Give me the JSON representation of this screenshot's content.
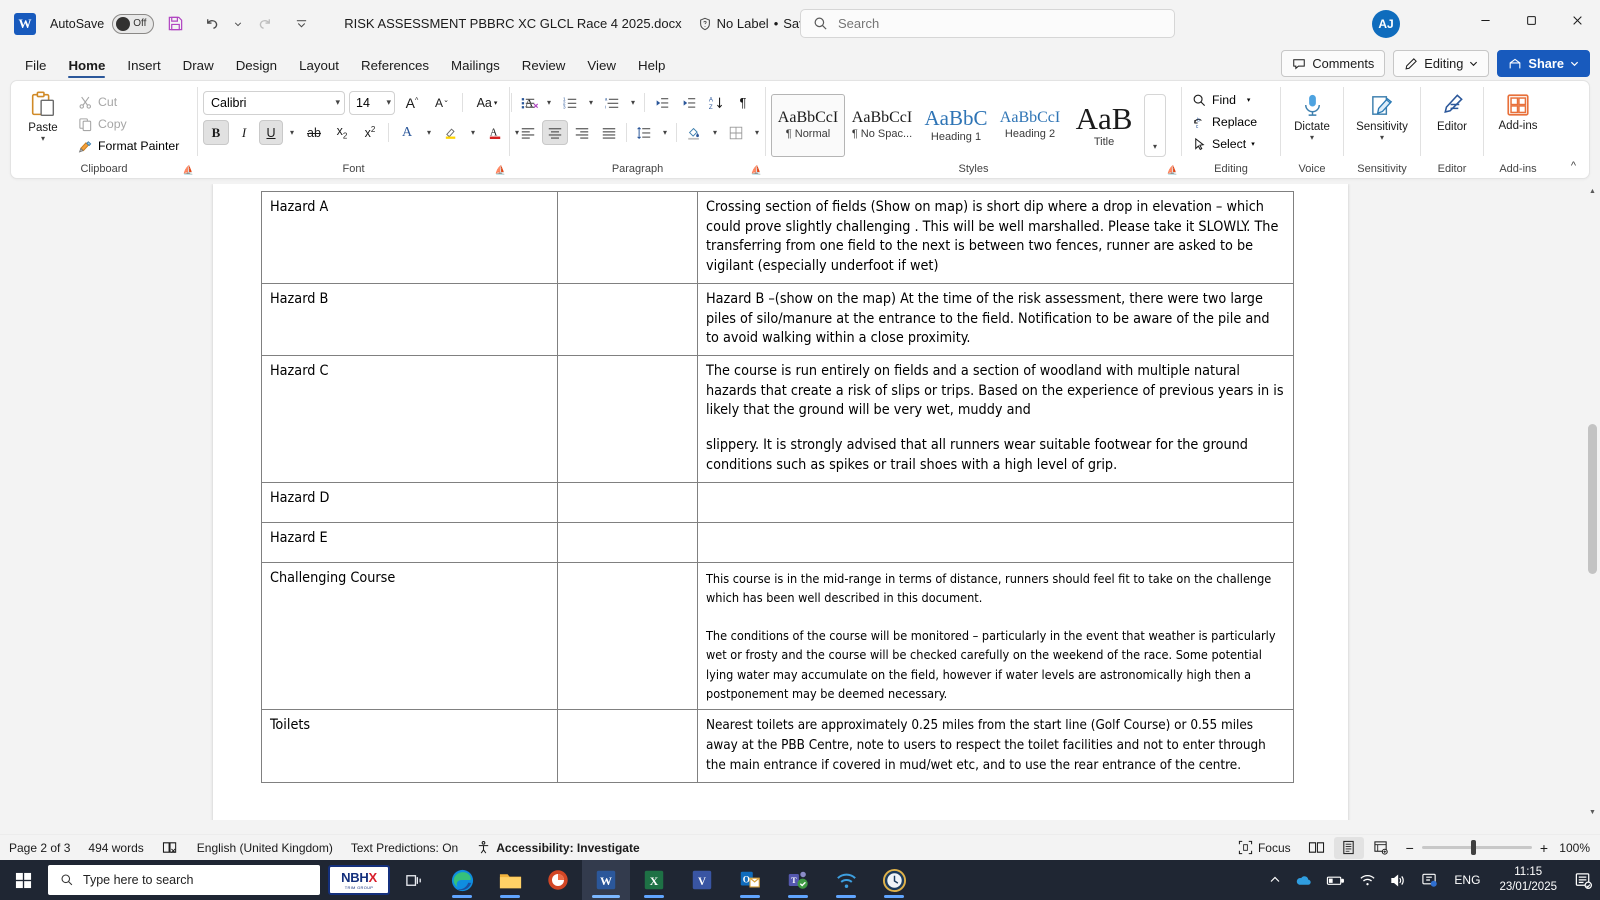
{
  "titlebar": {
    "app_logo": "word-logo",
    "autosave_label": "AutoSave",
    "autosave_state": "Off",
    "document_name": "RISK ASSESSMENT PBBRC XC GLCL Race 4 2025.docx",
    "sensitivity_label": "No Label",
    "save_state": "Saved to this PC",
    "separator": "•",
    "account_initials": "AJ"
  },
  "search": {
    "placeholder": "Search"
  },
  "tabs": [
    {
      "label": "File",
      "active": false
    },
    {
      "label": "Home",
      "active": true
    },
    {
      "label": "Insert",
      "active": false
    },
    {
      "label": "Draw",
      "active": false
    },
    {
      "label": "Design",
      "active": false
    },
    {
      "label": "Layout",
      "active": false
    },
    {
      "label": "References",
      "active": false
    },
    {
      "label": "Mailings",
      "active": false
    },
    {
      "label": "Review",
      "active": false
    },
    {
      "label": "View",
      "active": false
    },
    {
      "label": "Help",
      "active": false
    }
  ],
  "ribbon_actions": {
    "comments": "Comments",
    "editing": "Editing",
    "share": "Share"
  },
  "ribbon": {
    "clipboard": {
      "group_label": "Clipboard",
      "paste": "Paste",
      "cut": "Cut",
      "copy": "Copy",
      "format_painter": "Format Painter"
    },
    "font": {
      "group_label": "Font",
      "font_name": "Calibri",
      "font_size": "14",
      "bold_active": true
    },
    "paragraph": {
      "group_label": "Paragraph"
    },
    "styles": {
      "group_label": "Styles",
      "items": [
        {
          "preview": "AaBbCcI",
          "name": "¶ Normal",
          "selected": true
        },
        {
          "preview": "AaBbCcI",
          "name": "¶ No Spac...",
          "selected": false
        },
        {
          "preview": "AaBbC",
          "name": "Heading 1",
          "selected": false
        },
        {
          "preview": "AaBbCcI",
          "name": "Heading 2",
          "selected": false
        },
        {
          "preview": "AaB",
          "name": "Title",
          "selected": false
        }
      ]
    },
    "editing": {
      "group_label": "Editing",
      "find": "Find",
      "replace": "Replace",
      "select": "Select"
    },
    "voice": {
      "group_label": "Voice",
      "dictate": "Dictate"
    },
    "sensitivity": {
      "group_label": "Sensitivity",
      "button": "Sensitivity"
    },
    "editor": {
      "group_label": "Editor",
      "button": "Editor"
    },
    "addins": {
      "group_label": "Add-ins",
      "button": "Add-ins"
    }
  },
  "document": {
    "table_rows": [
      {
        "label": "Hazard A",
        "mid": "",
        "paragraphs": [
          "Crossing section of fields (Show on map) is short dip where a drop in elevation – which could prove slightly challenging .  This will be well marshalled.  Please take it SLOWLY.  The transferring from one field to the next is between two fences, runner are asked to be vigilant (especially underfoot if wet)"
        ]
      },
      {
        "label": "Hazard B",
        "mid": "",
        "paragraphs": [
          "Hazard B –(show on the map)  At the time of the risk assessment, there were two large piles of silo/manure at the entrance to the field. Notification to be aware of the pile and to avoid walking within a close proximity."
        ]
      },
      {
        "label": "Hazard C",
        "mid": "",
        "paragraphs": [
          "The course is run entirely on fields and a section of woodland with multiple natural hazards that create a risk of slips or trips. Based on the experience of previous years in is likely that the ground will be very wet, muddy and",
          "slippery. It is strongly advised that all runners wear suitable footwear for the ground conditions such as spikes or trail shoes with a high level of grip."
        ]
      },
      {
        "label": "Hazard D",
        "mid": "",
        "paragraphs": []
      },
      {
        "label": "Hazard E",
        "mid": "",
        "paragraphs": []
      },
      {
        "label": "Challenging Course",
        "mid": "",
        "paragraphs": [
          "This course is in the mid-range in terms of distance, runners should feel fit to take on the challenge which has been well described in this document.",
          "The conditions of the course will be monitored – particularly in the event that weather is particularly wet or frosty and the course will be checked carefully on the weekend of the race. Some potential lying water may accumulate on the field, however if water levels are astronomically high then a postponement may be deemed necessary."
        ]
      },
      {
        "label": "Toilets",
        "mid": "",
        "paragraphs": [
          "Nearest toilets are approximately 0.25 miles from the start line (Golf Course) or 0.55 miles away at the PBB Centre, note to users to respect the toilet facilities and not to enter through the main entrance if covered in mud/wet etc, and to use the rear entrance of the centre."
        ]
      }
    ]
  },
  "statusbar": {
    "page": "Page 2 of 3",
    "words": "494 words",
    "language": "English (United Kingdom)",
    "text_predictions": "Text Predictions: On",
    "accessibility": "Accessibility: Investigate",
    "focus": "Focus",
    "zoom_level": "100%"
  },
  "taskbar": {
    "search_placeholder": "Type here to search",
    "nbhx_name": "NBHX",
    "nbhx_sub": "TRIM GROUP",
    "language": "ENG",
    "time": "11:15",
    "date": "23/01/2025"
  },
  "colors": {
    "word_blue": "#185abd",
    "ribbon_accent": "#2b579a",
    "taskbar_bg": "#1f2633",
    "share_blue": "#185abd"
  }
}
